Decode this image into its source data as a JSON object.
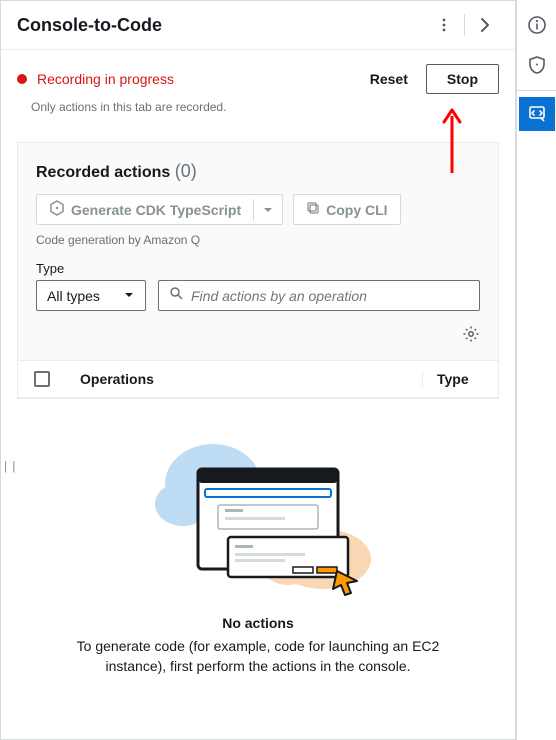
{
  "titlebar": {
    "title": "Console-to-Code"
  },
  "status": {
    "text": "Recording in progress",
    "reset_label": "Reset",
    "stop_label": "Stop",
    "note": "Only actions in this tab are recorded."
  },
  "recorded": {
    "title": "Recorded actions",
    "count": "(0)",
    "generate_label": "Generate CDK TypeScript",
    "copy_label": "Copy CLI",
    "generation_note": "Code generation by Amazon Q"
  },
  "filter": {
    "label": "Type",
    "selected": "All types",
    "search_placeholder": "Find actions by an operation"
  },
  "table": {
    "col_operations": "Operations",
    "col_type": "Type"
  },
  "empty": {
    "title": "No actions",
    "desc": "To generate code (for example, code for launching an EC2 instance), first perform the actions in the console."
  }
}
